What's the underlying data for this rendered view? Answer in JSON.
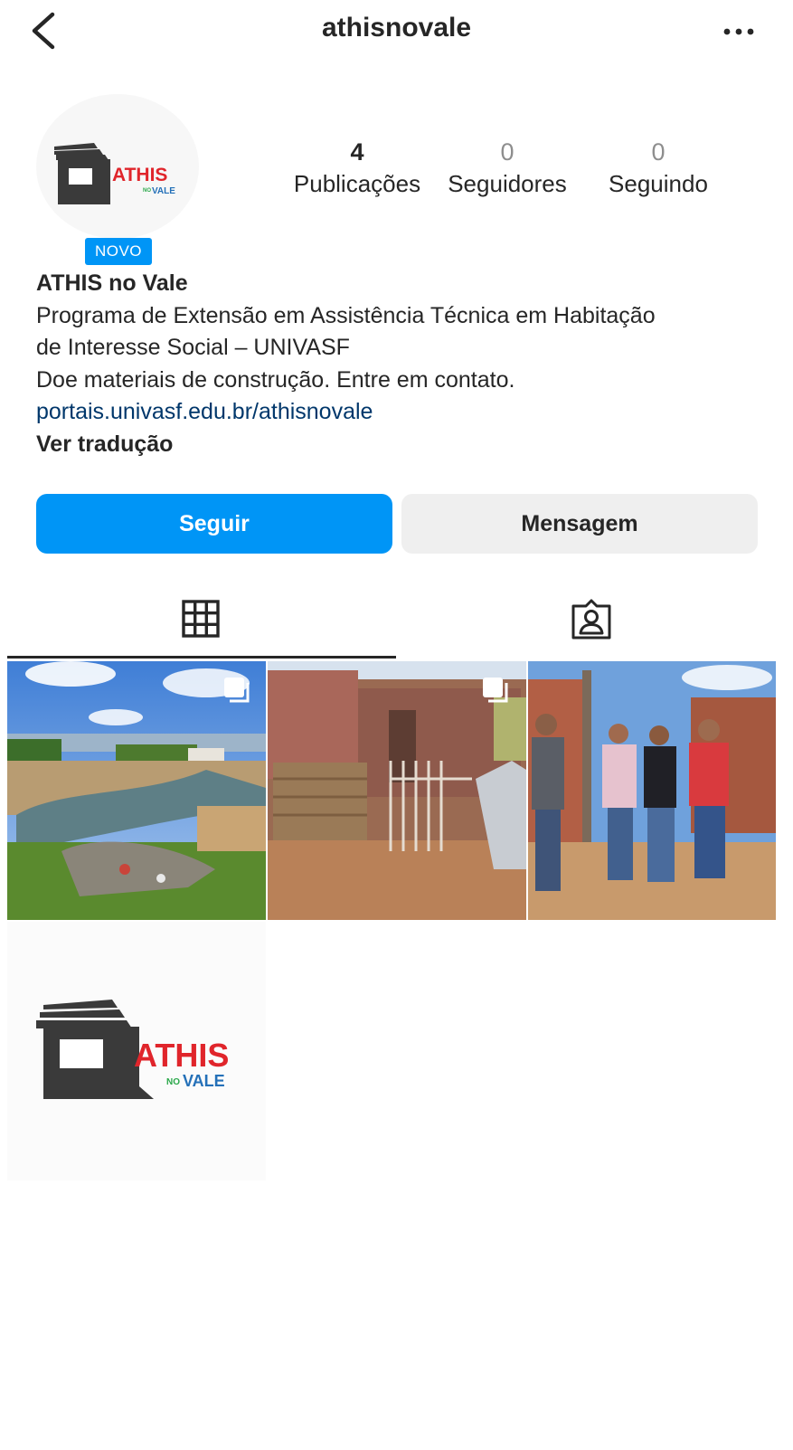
{
  "header": {
    "username": "athisnovale",
    "back_icon": "chevron-left-icon",
    "more_icon": "more-horizontal-icon"
  },
  "profile": {
    "logo_text": "ATHIS",
    "logo_sub_no": "NO",
    "logo_sub_vale": "VALE",
    "badge": "NOVO",
    "stats": {
      "posts_count": "4",
      "posts_label": "Publicações",
      "followers_count": "0",
      "followers_label": "Seguidores",
      "following_count": "0",
      "following_label": "Seguindo"
    },
    "name": "ATHIS no Vale",
    "bio_line1": "Programa de Extensão em Assistência Técnica em Habitação",
    "bio_line2": "de Interesse Social – UNIVASF",
    "bio_line3": "Doe materiais de construção. Entre em contato.",
    "link": "portais.univasf.edu.br/athisnovale",
    "translate": "Ver tradução"
  },
  "actions": {
    "follow_label": "Seguir",
    "message_label": "Mensagem"
  },
  "tabs": [
    {
      "icon": "grid-icon",
      "active": true
    },
    {
      "icon": "tagged-person-icon",
      "active": false
    }
  ],
  "posts": [
    {
      "subject": "riverbank-landscape",
      "multi": true
    },
    {
      "subject": "brick-house-gate",
      "multi": true
    },
    {
      "subject": "team-group-photo",
      "multi": false
    },
    {
      "subject": "athis-logo",
      "multi": false
    }
  ],
  "colors": {
    "accent": "#0095f6",
    "logo_red": "#e0252b",
    "logo_blue": "#2470b8",
    "logo_green": "#2aa84a",
    "logo_dark": "#3a3a3a"
  }
}
